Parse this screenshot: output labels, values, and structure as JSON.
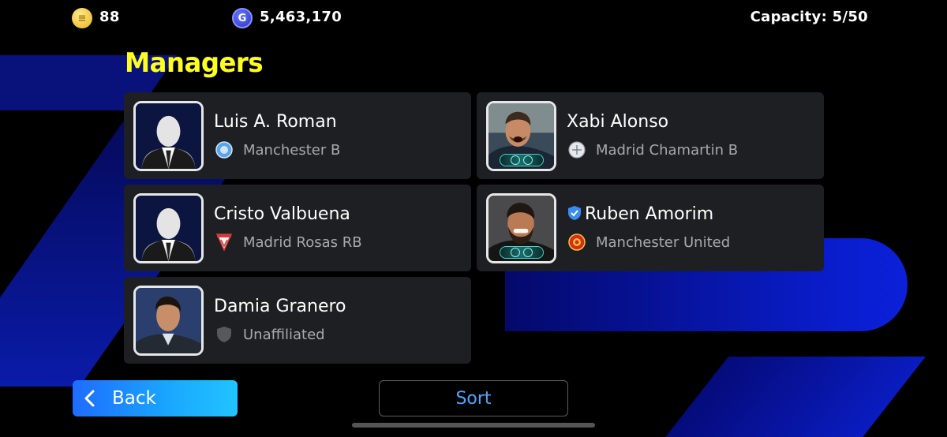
{
  "header": {
    "coins": "88",
    "coins_icon": "ecoin-icon",
    "gp": "5,463,170",
    "gp_icon": "gp-icon",
    "capacity": "Capacity: 5/50"
  },
  "page_title": "Managers",
  "managers": [
    {
      "name": "Luis A. Roman",
      "team": "Manchester B",
      "portrait": "silhouette",
      "crest": "manchester-b-crest-icon"
    },
    {
      "name": "Xabi Alonso",
      "team": "Madrid Chamartin B",
      "portrait": "photo",
      "crest": "madrid-chamartin-b-crest-icon"
    },
    {
      "name": "Cristo Valbuena",
      "team": "Madrid Rosas RB",
      "portrait": "silhouette",
      "crest": "madrid-rosas-rb-crest-icon"
    },
    {
      "name": "Ruben Amorim",
      "team": "Manchester United",
      "portrait": "photo",
      "crest": "manchester-united-crest-icon",
      "verified": true
    },
    {
      "name": "Damia Granero",
      "team": "Unaffiliated",
      "portrait": "photo",
      "crest": "unaffiliated-shield-icon"
    }
  ],
  "buttons": {
    "back": "Back",
    "sort": "Sort"
  },
  "colors": {
    "title": "#ffff1f",
    "card": "#1e1f23",
    "back_button": "#1e6cff",
    "sort_text": "#4aa5ff",
    "background_accent": "#0a1ed0"
  }
}
